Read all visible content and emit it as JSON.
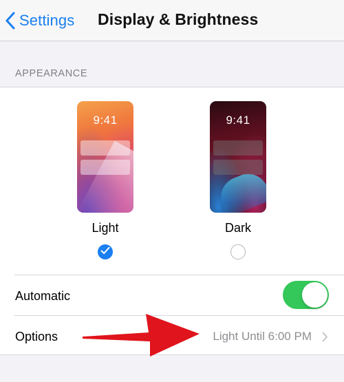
{
  "nav": {
    "back_label": "Settings",
    "title": "Display & Brightness"
  },
  "appearance": {
    "section_header": "APPEARANCE",
    "options": [
      {
        "label": "Light",
        "time": "9:41",
        "selected": true
      },
      {
        "label": "Dark",
        "time": "9:41",
        "selected": false
      }
    ]
  },
  "automatic": {
    "label": "Automatic",
    "enabled": true
  },
  "options_row": {
    "label": "Options",
    "value": "Light Until 6:00 PM"
  },
  "colors": {
    "accent": "#1a7ff0",
    "toggle_on": "#34c759",
    "annotation": "#e0141c"
  },
  "icons": {
    "back": "chevron-left-icon",
    "check": "checkmark-icon",
    "disclosure": "chevron-right-icon",
    "annotation": "red-arrow-icon"
  }
}
